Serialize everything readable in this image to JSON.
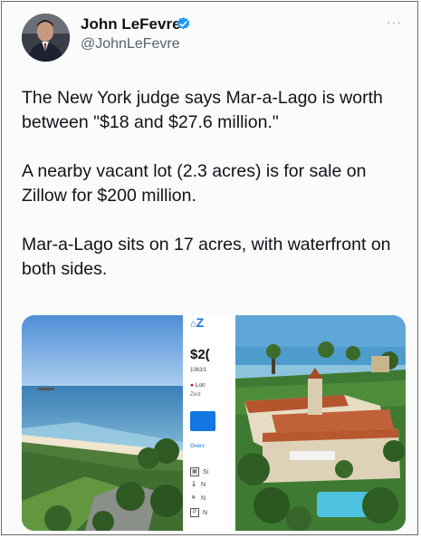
{
  "author": {
    "name": "John LeFevre",
    "handle": "@JohnLeFevre",
    "verified_color": "#1d9bf0"
  },
  "more_label": "···",
  "tweet": {
    "paragraphs": [
      "The New York judge says Mar-a-Lago is worth between \"$18 and $27.6 million.\"",
      "A nearby vacant lot (2.3 acres) is for sale on Zillow for $200 million.",
      "Mar-a-Lago sits on 17 acres, with waterfront on both sides."
    ]
  },
  "zillow": {
    "logo": "Z",
    "price": "$2(",
    "address": "1063/1",
    "status": "Lot/",
    "zestimate": "Zest",
    "overview": "Overv",
    "facts": [
      {
        "icon": "building-icon",
        "text": "Si"
      },
      {
        "icon": "thermometer-icon",
        "text": "N"
      },
      {
        "icon": "snowflake-icon",
        "text": "N"
      },
      {
        "icon": "parking-icon",
        "text": "N"
      }
    ]
  },
  "colors": {
    "text": "#0f1419",
    "secondary": "#536471",
    "zillow_blue": "#1277e1"
  }
}
